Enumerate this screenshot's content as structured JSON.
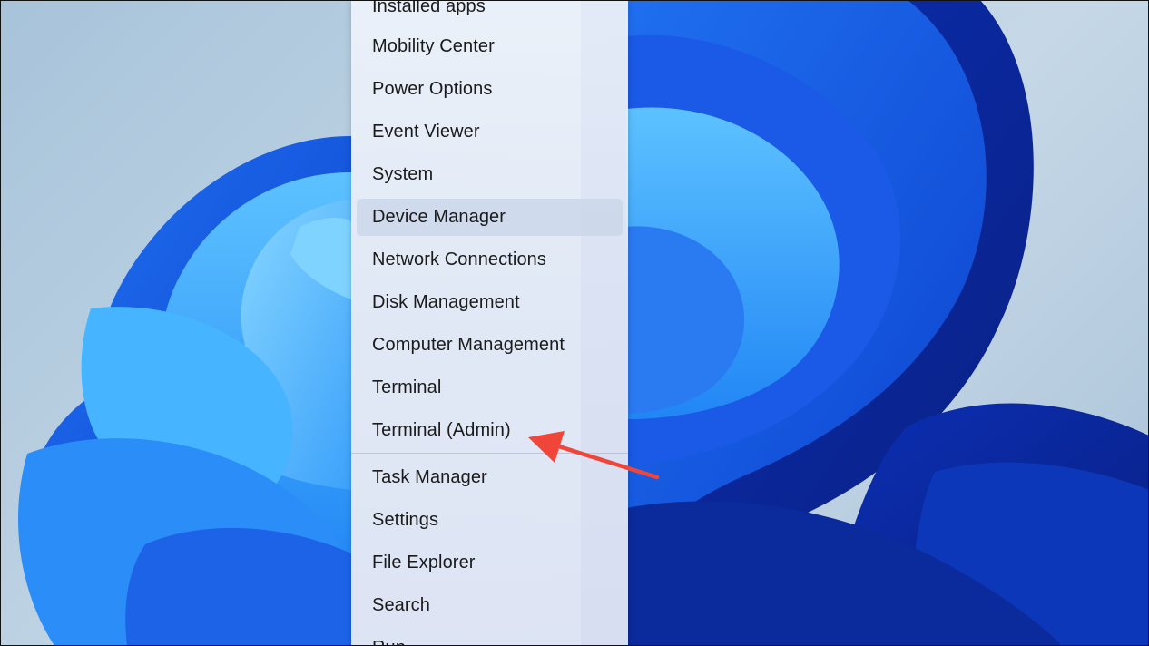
{
  "context_menu": {
    "items": [
      {
        "label": "Installed apps"
      },
      {
        "label": "Mobility Center"
      },
      {
        "label": "Power Options"
      },
      {
        "label": "Event Viewer"
      },
      {
        "label": "System"
      },
      {
        "label": "Device Manager",
        "highlighted": true
      },
      {
        "label": "Network Connections"
      },
      {
        "label": "Disk Management"
      },
      {
        "label": "Computer Management"
      },
      {
        "label": "Terminal"
      },
      {
        "label": "Terminal (Admin)"
      },
      {
        "label": "Task Manager"
      },
      {
        "label": "Settings"
      },
      {
        "label": "File Explorer"
      },
      {
        "label": "Search"
      },
      {
        "label": "Run"
      }
    ]
  },
  "annotation": {
    "type": "arrow",
    "color": "#f0463a",
    "points_to": "Terminal (Admin)"
  },
  "wallpaper": {
    "name": "Windows 11 Bloom",
    "colors": [
      "#0a3fd0",
      "#1f73f0",
      "#3fa6ff"
    ]
  }
}
